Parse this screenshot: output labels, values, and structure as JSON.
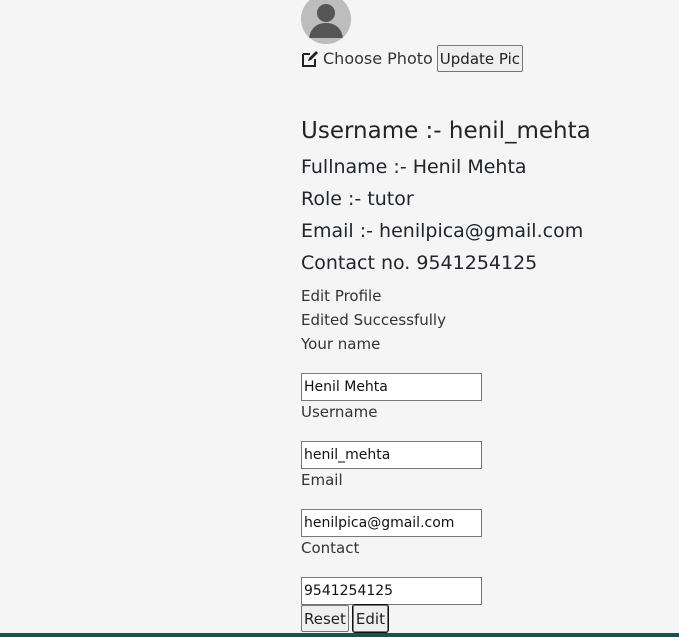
{
  "profile": {
    "choose_photo_label": "Choose Photo",
    "update_pic_label": "Update Pic",
    "username_line": "Username :- henil_mehta",
    "fullname_line": "Fullname :- Henil Mehta",
    "role_line": "Role :- tutor",
    "email_line": "Email :- henilpica@gmail.com",
    "contact_line": "Contact no. 9541254125"
  },
  "edit_form": {
    "title": "Edit Profile",
    "status_message": "Edited Successfully",
    "fields": {
      "name": {
        "label": "Your name",
        "value": "Henil Mehta"
      },
      "username": {
        "label": "Username",
        "value": "henil_mehta"
      },
      "email": {
        "label": "Email",
        "value": "henilpica@gmail.com"
      },
      "contact": {
        "label": "Contact",
        "value": "9541254125"
      }
    },
    "reset_label": "Reset",
    "edit_label": "Edit"
  },
  "icons": {
    "avatar": "user-avatar-icon",
    "edit": "pencil-square-icon"
  },
  "colors": {
    "background": "#f5f5f5",
    "footer": "#1f4f4f",
    "avatar": "#bdbdbd"
  }
}
